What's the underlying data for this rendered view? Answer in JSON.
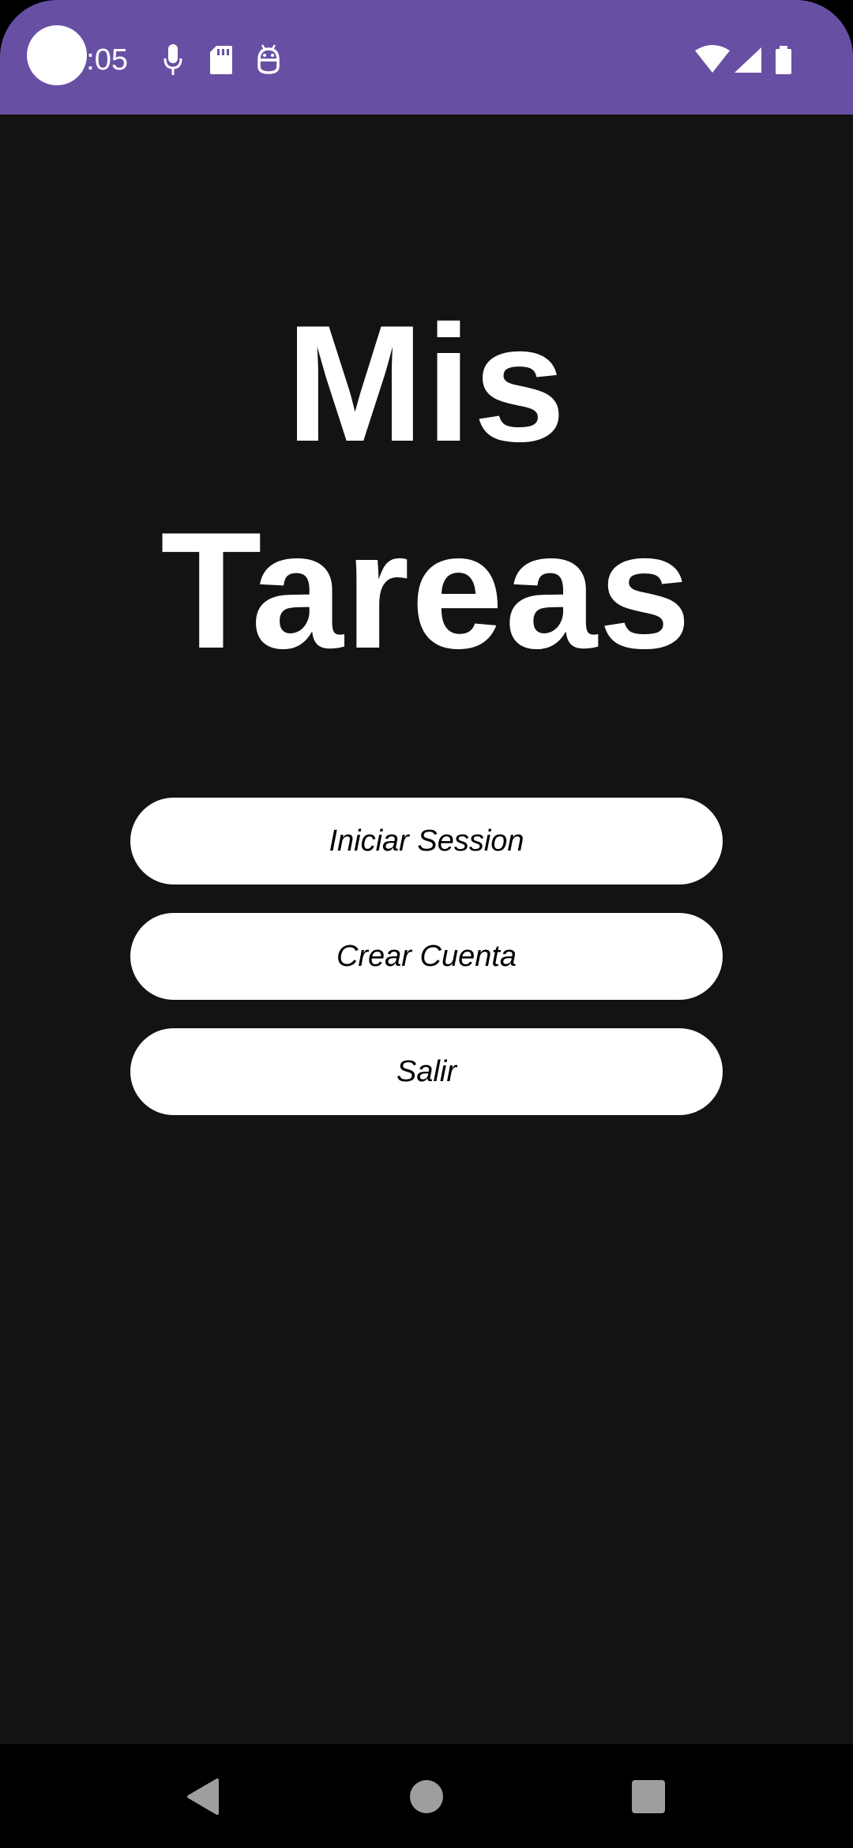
{
  "status_bar": {
    "time": "3:05",
    "background_color": "#6750a4",
    "left_icons": [
      "mic-icon",
      "sd-card-icon",
      "android-robot-icon"
    ],
    "right_icons": [
      "wifi-icon",
      "cell-signal-icon",
      "battery-icon"
    ]
  },
  "main": {
    "title_line1": "Mis",
    "title_line2": "Tareas",
    "background_color": "#131313"
  },
  "buttons": {
    "login_label": "Iniciar Session",
    "create_account_label": "Crear Cuenta",
    "exit_label": "Salir"
  },
  "nav_bar": {
    "icons": [
      "back-icon",
      "home-icon",
      "recents-icon"
    ]
  }
}
